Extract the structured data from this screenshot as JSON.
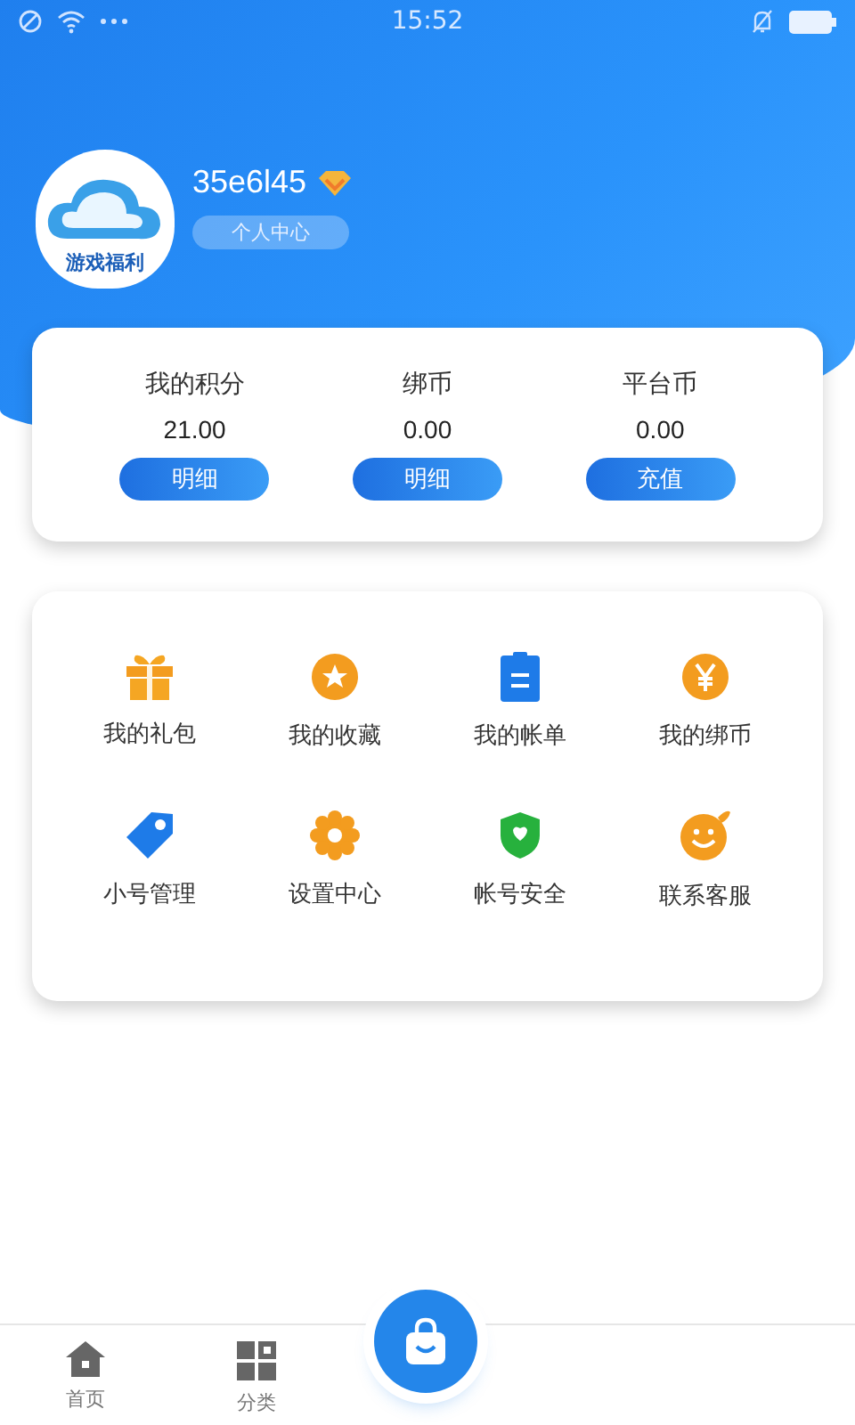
{
  "status_bar": {
    "time": "15:52"
  },
  "profile": {
    "avatar_caption": "游戏福利",
    "username": "35e6l45",
    "center_link": "个人中心"
  },
  "balances": [
    {
      "label": "我的积分",
      "value": "21.00",
      "action": "明细"
    },
    {
      "label": "绑币",
      "value": "0.00",
      "action": "明细"
    },
    {
      "label": "平台币",
      "value": "0.00",
      "action": "充值"
    }
  ],
  "menu": [
    {
      "label": "我的礼包",
      "kind": "gift"
    },
    {
      "label": "我的收藏",
      "kind": "star"
    },
    {
      "label": "我的帐单",
      "kind": "bill"
    },
    {
      "label": "我的绑币",
      "kind": "yen"
    },
    {
      "label": "小号管理",
      "kind": "tag"
    },
    {
      "label": "设置中心",
      "kind": "gear"
    },
    {
      "label": "帐号安全",
      "kind": "shield"
    },
    {
      "label": "联系客服",
      "kind": "smile"
    }
  ],
  "tab_bar": [
    {
      "label": "首页",
      "kind": "home",
      "selected": false
    },
    {
      "label": "分类",
      "kind": "grid",
      "selected": false
    }
  ]
}
